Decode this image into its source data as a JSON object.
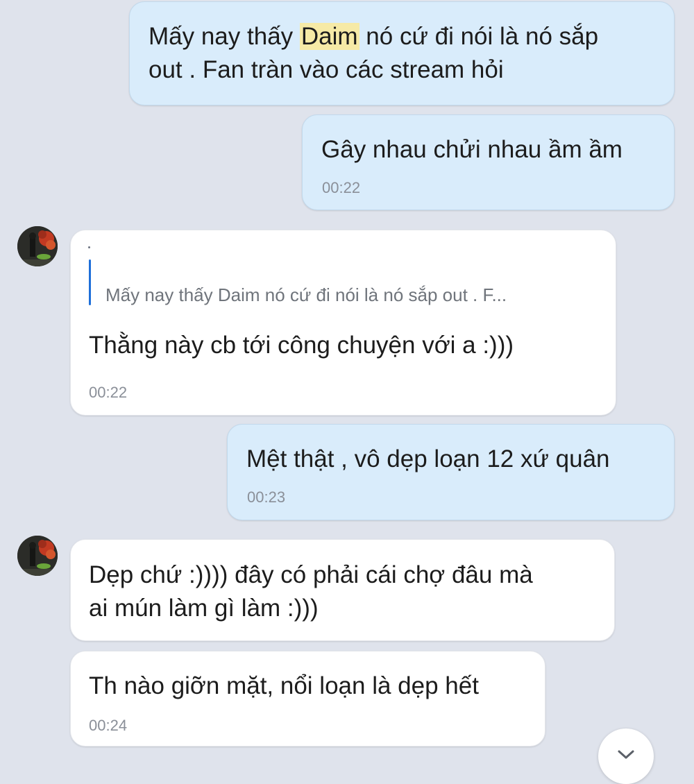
{
  "messages": [
    {
      "sender": "me",
      "text_before": "Mấy nay thấy ",
      "highlight": "Daim",
      "text_after": " nó cứ đi nói là nó sắp\nout . Fan tràn vào các stream hỏi"
    },
    {
      "sender": "me",
      "text": "Gây nhau chửi nhau ầm ầm",
      "time": "00:22"
    },
    {
      "sender": "other",
      "quote": "Mấy nay thấy Daim nó cứ đi nói là nó sắp out . F...",
      "text": "Thằng này cb tới công chuyện với a :)))",
      "time": "00:22"
    },
    {
      "sender": "me",
      "text": "Mệt thật , vô dẹp loạn 12 xứ quân",
      "time": "00:23"
    },
    {
      "sender": "other",
      "text": "Dẹp chứ :)))) đây có phải cái chợ đâu mà\nai mún làm gì làm :)))"
    },
    {
      "sender": "other",
      "text": "Th nào giỡn mặt, nổi loạn là dẹp hết",
      "time": "00:24"
    }
  ],
  "colors": {
    "background": "#dfe3ec",
    "outgoing_bubble": "#d9ecfb",
    "incoming_bubble": "#ffffff",
    "highlight": "#f6eaa6",
    "quote_bar": "#1e6fd9"
  },
  "icons": {
    "avatar": "avatar-photo",
    "scroll": "chevron-down-icon"
  }
}
